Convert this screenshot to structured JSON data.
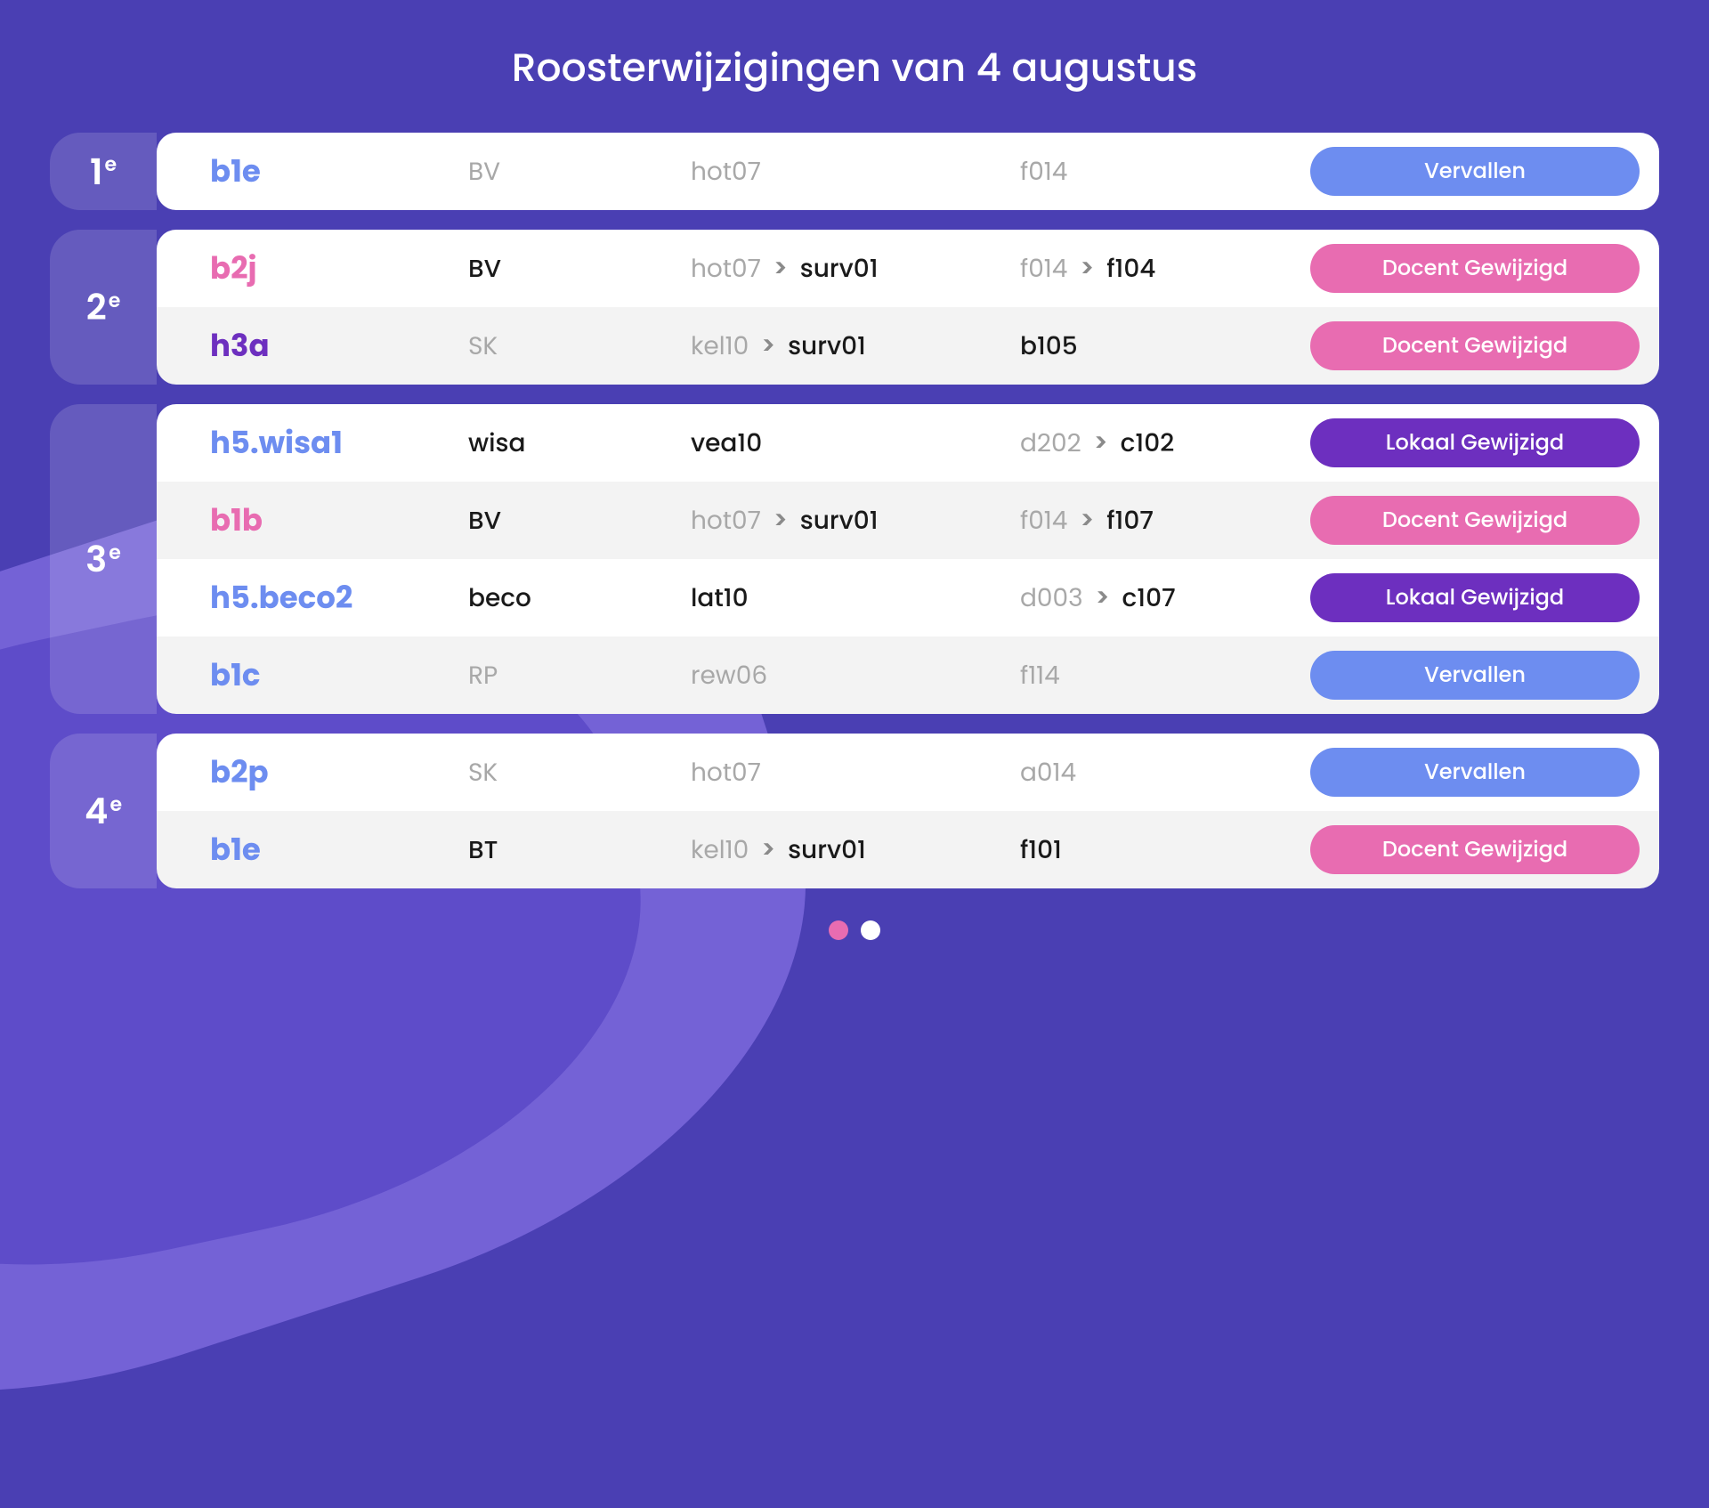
{
  "title": "Roosterwijzigingen van 4 augustus",
  "badge_labels": {
    "vervallen": "Vervallen",
    "docent": "Docent Gewijzigd",
    "lokaal": "Lokaal Gewijzigd"
  },
  "periods": [
    {
      "label_num": "1",
      "label_suffix": "e",
      "rows": [
        {
          "group": "b1e",
          "group_color": "blue",
          "subject": "BV",
          "teacher_from": "hot07",
          "teacher_to": null,
          "room_from": "f014",
          "room_to": null,
          "badge": "vervallen",
          "subject_del": true,
          "teacher_del": true,
          "room_del": true
        }
      ]
    },
    {
      "label_num": "2",
      "label_suffix": "e",
      "rows": [
        {
          "group": "b2j",
          "group_color": "pink",
          "subject": "BV",
          "teacher_from": "hot07",
          "teacher_to": "surv01",
          "room_from": "f014",
          "room_to": "f104",
          "badge": "docent"
        },
        {
          "group": "h3a",
          "group_color": "purple",
          "subject": "SK",
          "teacher_from": "kel10",
          "teacher_to": "surv01",
          "room_from": "b105",
          "room_to": null,
          "badge": "docent",
          "subject_del": true
        }
      ]
    },
    {
      "label_num": "3",
      "label_suffix": "e",
      "rows": [
        {
          "group": "h5.wisa1",
          "group_color": "blue",
          "subject": "wisa",
          "teacher_from": "vea10",
          "teacher_to": null,
          "room_from": "d202",
          "room_to": "c102",
          "badge": "lokaal"
        },
        {
          "group": "b1b",
          "group_color": "pink",
          "subject": "BV",
          "teacher_from": "hot07",
          "teacher_to": "surv01",
          "room_from": "f014",
          "room_to": "f107",
          "badge": "docent"
        },
        {
          "group": "h5.beco2",
          "group_color": "blue",
          "subject": "beco",
          "teacher_from": "lat10",
          "teacher_to": null,
          "room_from": "d003",
          "room_to": "c107",
          "badge": "lokaal"
        },
        {
          "group": "b1c",
          "group_color": "blue",
          "subject": "RP",
          "teacher_from": "rew06",
          "teacher_to": null,
          "room_from": "f114",
          "room_to": null,
          "badge": "vervallen",
          "subject_del": true,
          "teacher_del": true,
          "room_del": true
        }
      ]
    },
    {
      "label_num": "4",
      "label_suffix": "e",
      "rows": [
        {
          "group": "b2p",
          "group_color": "blue",
          "subject": "SK",
          "teacher_from": "hot07",
          "teacher_to": null,
          "room_from": "a014",
          "room_to": null,
          "badge": "vervallen",
          "subject_del": true,
          "teacher_del": true,
          "room_del": true
        },
        {
          "group": "b1e",
          "group_color": "blue",
          "subject": "BT",
          "teacher_from": "kel10",
          "teacher_to": "surv01",
          "room_from": "f101",
          "room_to": null,
          "badge": "docent"
        }
      ]
    }
  ],
  "pager": {
    "total": 2,
    "active": 0
  }
}
